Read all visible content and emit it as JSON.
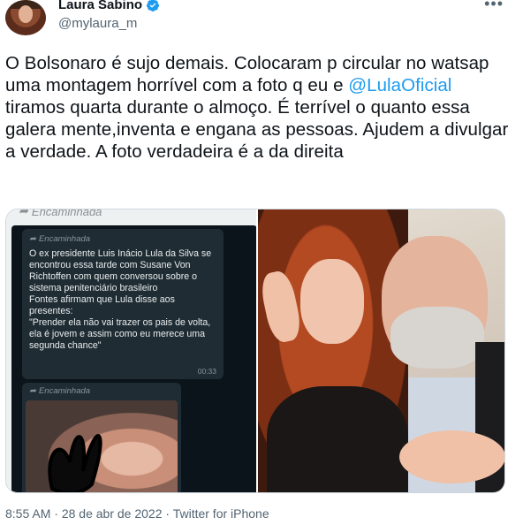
{
  "author": {
    "name": "Laura Sabino",
    "handle": "@mylaura_m",
    "verified": true,
    "verified_color": "#1d9bf0"
  },
  "tweet": {
    "text_part1": "O Bolsonaro é sujo demais. Colocaram p  circular no watsap uma montagem horrível com a foto q eu e ",
    "mention": "@LulaOficial",
    "text_part2": " tiramos quarta durante o almoço. É terrível o quanto essa galera mente,inventa e engana as pessoas. Ajudem a divulgar a verdade. A foto verdadeira é a da direita"
  },
  "media": {
    "left": {
      "top_forwarded_label": "Encaminhada",
      "bubble1": {
        "forwarded_label": "Encaminhada",
        "text": "O ex presidente Luis Inácio Lula da Silva se encontrou essa tarde com Susane Von Richtoffen com quem conversou sobre o sistema penitenciário brasileiro\nFontes afirmam que Lula disse aos presentes:\n\"Prender ela não vai trazer os pais de volta, ela é jovem e assim como eu merece uma segunda chance\"",
        "time": "00:33"
      },
      "bubble2": {
        "forwarded_label": "Encaminhada"
      }
    }
  },
  "footer": {
    "time": "8:55 AM",
    "separator": " · ",
    "date": "28 de abr de 2022",
    "source": "Twitter for iPhone"
  },
  "colors": {
    "accent": "#1d9bf0",
    "secondary_text": "#536471",
    "whatsapp_bg": "#0b141a",
    "whatsapp_bubble": "#1f2c33"
  }
}
